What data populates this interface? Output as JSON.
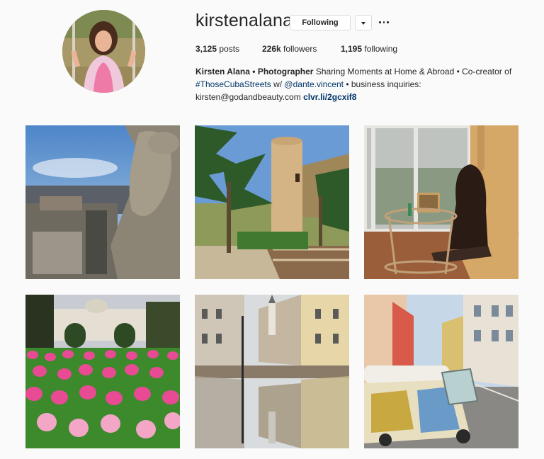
{
  "profile": {
    "username": "kirstenalana",
    "follow_label": "Following",
    "posts_count": "3,125",
    "posts_label": "posts",
    "followers_count": "226k",
    "followers_label": "followers",
    "following_count": "1,195",
    "following_label": "following",
    "bio": {
      "name": "Kirsten Alana",
      "separator": "•",
      "title": "Photographer",
      "text1": "Sharing Moments at Home & Abroad • Co-creator of",
      "hashtag": "#ThoseCubaStreets",
      "text2": "w/",
      "mention": "@dante.vincent",
      "text3": "• business inquiries:",
      "email": "kirsten@godandbeauty.com",
      "short_link": "clvr.li/2gcxif8"
    }
  },
  "icons": {
    "more": "more-options-icon",
    "dropdown": "chevron-down-icon"
  },
  "colors": {
    "link": "#003569",
    "border": "#dbdbdb",
    "text": "#262626",
    "background": "#fafafa"
  }
}
